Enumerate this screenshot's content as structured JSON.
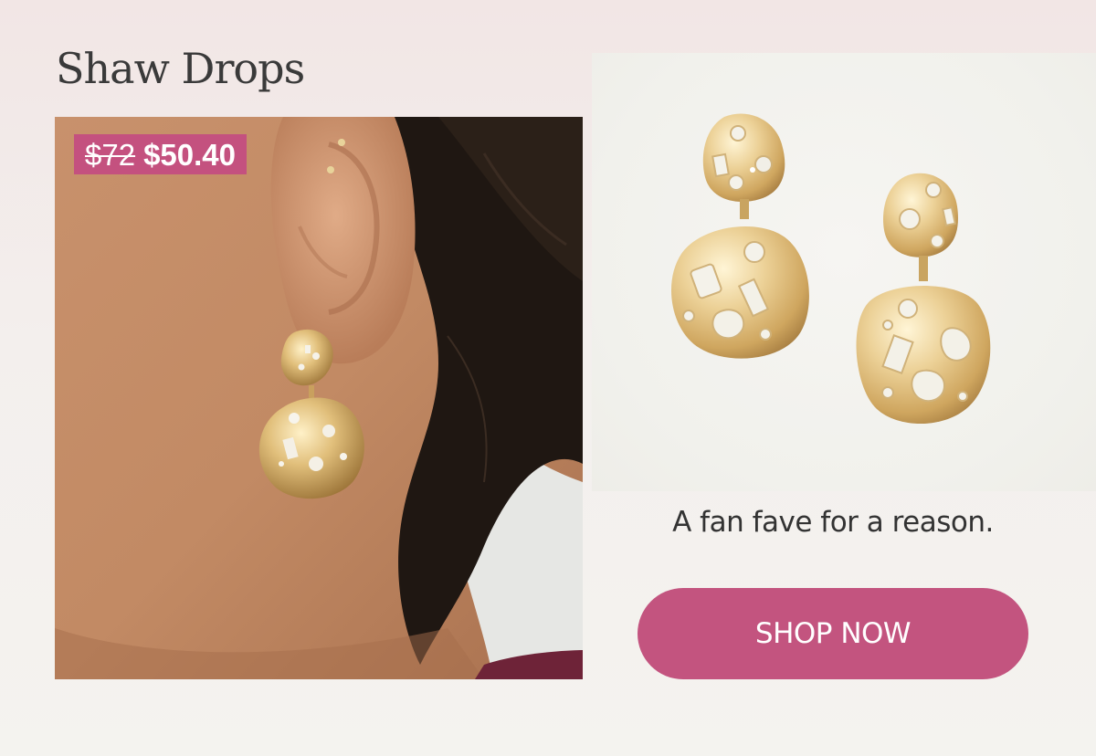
{
  "product": {
    "name": "Shaw Drops",
    "price_original": "$72",
    "price_sale": "$50.40"
  },
  "promo": {
    "tagline": "A fan fave for a reason.",
    "cta_label": "SHOP NOW"
  },
  "colors": {
    "accent_pink": "#c3547f",
    "title_text": "#3a3a3a",
    "body_text": "#333333",
    "gold": "#d9b676"
  }
}
